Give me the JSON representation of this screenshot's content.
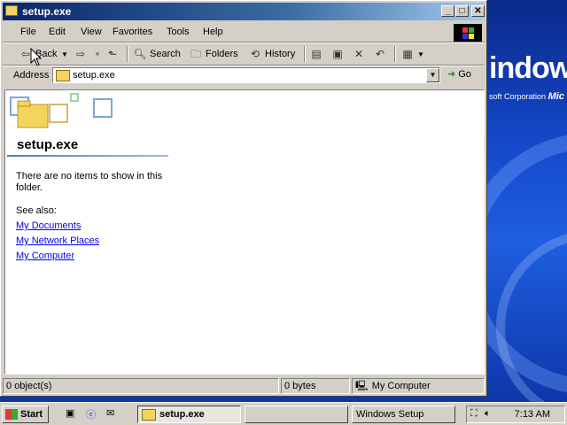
{
  "desktop": {
    "logo_text": "indows",
    "corp_text": "soft Corporation",
    "corp_bold": "Mic"
  },
  "window": {
    "title": "setup.exe",
    "controls": {
      "minimize": "_",
      "maximize": "□",
      "close": "✕"
    }
  },
  "menu": {
    "items": [
      "File",
      "Edit",
      "View",
      "Favorites",
      "Tools",
      "Help"
    ]
  },
  "toolbar": {
    "back": "Back",
    "search": "Search",
    "folders": "Folders",
    "history": "History"
  },
  "address": {
    "label": "Address",
    "value": "setup.exe",
    "go": "Go"
  },
  "content": {
    "folder_title": "setup.exe",
    "empty_message": "There are no items to show in this folder.",
    "see_also": "See also:",
    "links": [
      "My Documents",
      "My Network Places",
      "My Computer"
    ]
  },
  "status": {
    "objects": "0 object(s)",
    "size": "0 bytes",
    "zone": "My Computer"
  },
  "taskbar": {
    "start": "Start",
    "apps": [
      {
        "label": "setup.exe",
        "active": true
      },
      {
        "label": "",
        "active": false
      },
      {
        "label": "Windows Setup",
        "active": false
      }
    ],
    "clock": "7:13 AM"
  },
  "colors": {
    "title_bar": "#0a246a",
    "desktop": "#1547c9",
    "link": "#0000ee"
  }
}
